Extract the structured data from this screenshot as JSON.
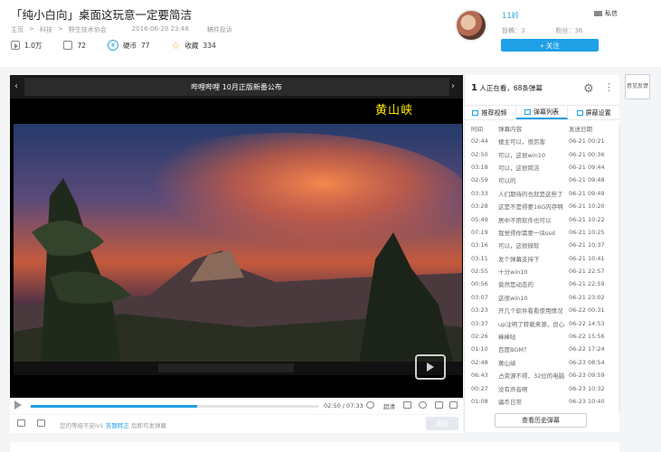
{
  "page": {
    "title": "「纯小白向」桌面这玩意一定要简洁",
    "breadcrumbs": [
      "主页",
      "科技",
      "野生技术协会"
    ],
    "sep": ">",
    "publish_time": "2016-06-20 23:48",
    "report_label": "稿件投诉",
    "stats": {
      "views": "1.0万",
      "danmaku": "72",
      "coins_label": "硬币",
      "coins": "77",
      "fav_label": "收藏",
      "favorites": "334"
    }
  },
  "uploader": {
    "name": "11岭",
    "message_label": "私信",
    "submissions": "投稿：3",
    "followers": "粉丝：36",
    "follow_label": "+ 关注"
  },
  "player": {
    "top_banner": "哔哩哔哩 10月正版新番公布",
    "overlay_text": "黄山峡",
    "progress": 0.58,
    "time": "02:50 / 07:33",
    "quality": "超清",
    "danmu_hint_pre": "您的等级不足lv1",
    "danmu_hint_link": "答题转正",
    "danmu_hint_post": "后即可发弹幕",
    "send_label": "发送"
  },
  "sidebar": {
    "viewers_count": "1",
    "viewers_text": "人正在看，68条弹幕",
    "tabs": [
      "推荐视频",
      "弹幕列表",
      "屏蔽设置"
    ],
    "columns": [
      "时间",
      "弹幕内容",
      "发送日期"
    ],
    "rows": [
      {
        "t": "02:44",
        "c": "楼主可以，很厉害",
        "d": "06-21 00:21"
      },
      {
        "t": "02:50",
        "c": "可以，这很win10",
        "d": "06-21 00:36"
      },
      {
        "t": "03:18",
        "c": "可以，这很简洁",
        "d": "06-21 09:44"
      },
      {
        "t": "02:59",
        "c": "可以的",
        "d": "06-21 09:48"
      },
      {
        "t": "03:33",
        "c": "人们期待的也就是这些了",
        "d": "06-21 09:49"
      },
      {
        "t": "03:28",
        "c": "这是不是得要16G内存啊",
        "d": "06-21 10:20"
      },
      {
        "t": "05:49",
        "c": "居中不用软件也可以",
        "d": "06-21 10:22"
      },
      {
        "t": "07:19",
        "c": "我觉得你需要一块ssd",
        "d": "06-21 10:25"
      },
      {
        "t": "03:16",
        "c": "可以，这很微软",
        "d": "06-21 10:37"
      },
      {
        "t": "03:11",
        "c": "发个弹幕支持下",
        "d": "06-21 10:41"
      },
      {
        "t": "02:55",
        "c": "十分win10",
        "d": "06-21 22:57"
      },
      {
        "t": "00:56",
        "c": "竟然是动态的",
        "d": "06-21 22:59"
      },
      {
        "t": "03:07",
        "c": "这很win10",
        "d": "06-21 23:02"
      },
      {
        "t": "03:23",
        "c": "开几个软件看看使用情况",
        "d": "06-22 00:31"
      },
      {
        "t": "03:37",
        "c": "up注明了转载来源，良心",
        "d": "06-22 14:53"
      },
      {
        "t": "02:26",
        "c": "棒棒哒",
        "d": "06-22 15:56"
      },
      {
        "t": "01:10",
        "c": "百度BGM？",
        "d": "06-22 17:24"
      },
      {
        "t": "02:48",
        "c": "黄山峡",
        "d": "06-23 08:54"
      },
      {
        "t": "06:43",
        "c": "占资源不得，32位的电脑",
        "d": "06-23 09:59"
      },
      {
        "t": "00:27",
        "c": "没有声音啊",
        "d": "06-23 10:32"
      },
      {
        "t": "01:08",
        "c": "骗币日常",
        "d": "06-23 10:40"
      }
    ],
    "history_label": "查看历史弹幕"
  },
  "feedback_label": "意见反馈",
  "colors": {
    "accent": "#1fa0e6",
    "overlay_yellow": "#ffe800"
  }
}
